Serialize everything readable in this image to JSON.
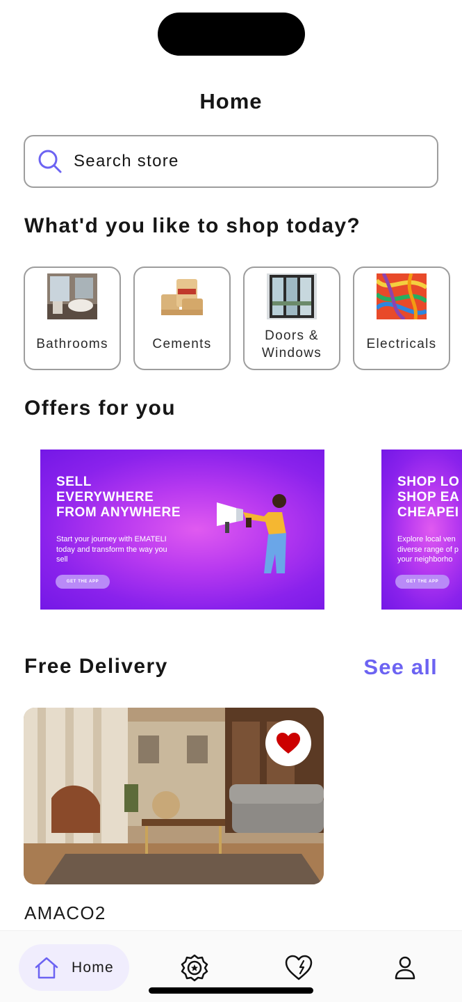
{
  "header": {
    "title": "Home"
  },
  "search": {
    "placeholder": "Search store"
  },
  "categories_section": {
    "title": "What'd you like to shop today?",
    "items": [
      {
        "label": "Bathrooms",
        "icon": "bathroom-photo"
      },
      {
        "label": "Cements",
        "icon": "cement-bags-photo"
      },
      {
        "label": "Doors & Windows",
        "icon": "glass-doors-photo"
      },
      {
        "label": "Electricals",
        "icon": "cables-photo"
      }
    ]
  },
  "offers": {
    "title": "Offers for you",
    "banners": [
      {
        "headline": "SELL\nEVERYWHERE\nFROM ANYWHERE",
        "body": "Start your journey with EMATELI\ntoday and transform the way you\nsell",
        "cta": "GET THE APP"
      },
      {
        "headline": "SHOP LO\nSHOP EA\nCHEAPEI",
        "body": "Explore local ven\ndiverse range of p\nyour neighborho",
        "cta": "GET THE APP"
      }
    ]
  },
  "free_delivery": {
    "title": "Free Delivery",
    "see_all": "See all",
    "products": [
      {
        "name": "AMACO2",
        "favorited": true,
        "image": "living-room-photo"
      }
    ]
  },
  "bottom_nav": {
    "items": [
      {
        "label": "Home",
        "icon": "home-icon",
        "active": true
      },
      {
        "label": "",
        "icon": "deals-badge-icon"
      },
      {
        "label": "",
        "icon": "heart-icon"
      },
      {
        "label": "",
        "icon": "profile-icon"
      }
    ]
  },
  "colors": {
    "accent": "#6c63f2",
    "banner": "#8a22ec",
    "heart": "#cc0000",
    "nav_active_bg": "#f0edfd"
  }
}
